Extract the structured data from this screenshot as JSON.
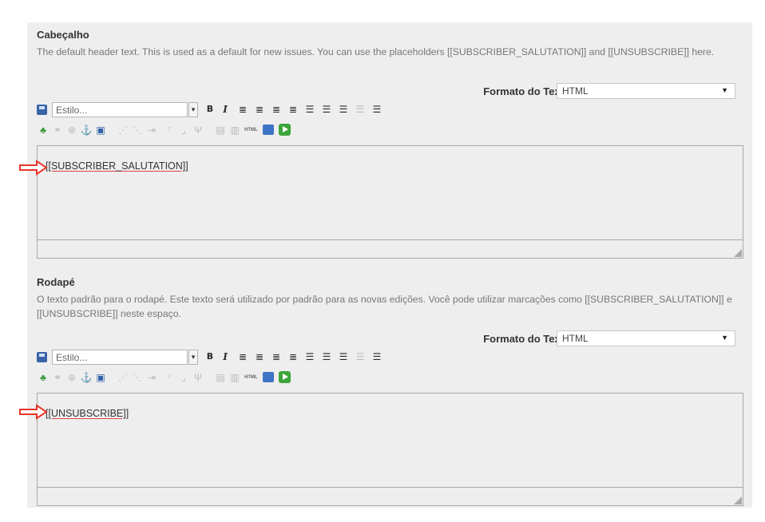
{
  "header_section": {
    "title": "Cabeçalho",
    "description": "The default header text. This is used as a default for new issues. You can use the placeholders [[SUBSCRIBER_SALUTATION]] and [[UNSUBSCRIBE]] here.",
    "format_label": "Formato do Texto",
    "format_value": "HTML",
    "style_placeholder": "Estilo...",
    "editor_content": "[[SUBSCRIBER_SALUTATION]]"
  },
  "footer_section": {
    "title": "Rodapé",
    "description": "O texto padrão para o rodapé. Este texto será utilizado por padrão para as novas edições. Você pode utilizar marcações como [[SUBSCRIBER_SALUTATION]] e [[UNSUBSCRIBE]] neste espaço.",
    "format_label": "Formato do Texto",
    "format_value": "HTML",
    "style_placeholder": "Estilo...",
    "editor_content": "[[UNSUBSCRIBE]]"
  },
  "toolbar": {
    "bold": "B",
    "italic": "I",
    "html_label": "HTML"
  },
  "colors": {
    "panel_bg": "#eeeeee",
    "arrow": "#e8352a",
    "underline": "#d44444"
  }
}
